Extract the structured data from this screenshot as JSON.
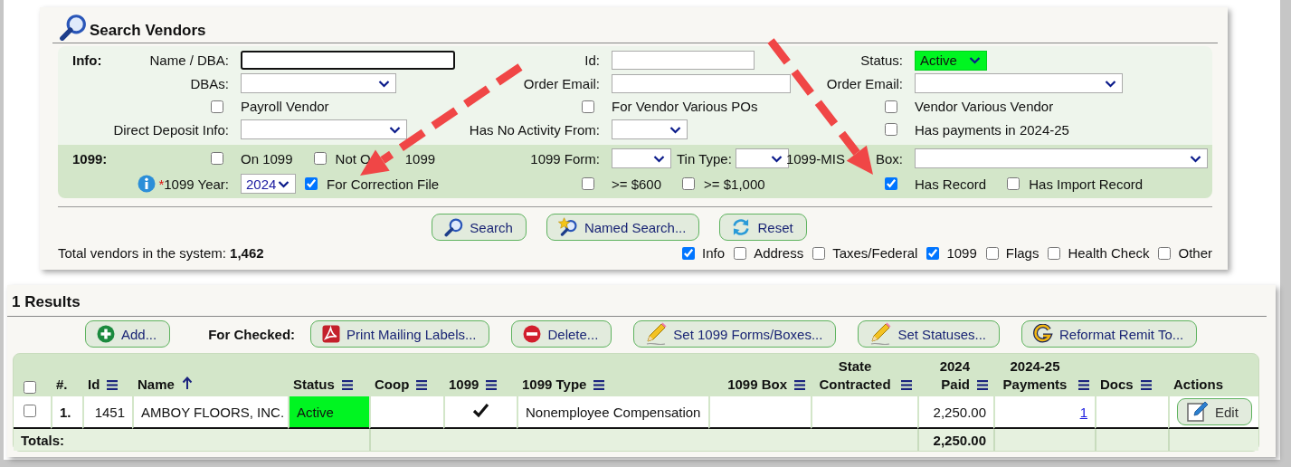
{
  "title": "Search Vendors",
  "form": {
    "sections": [
      {
        "label": "Info:",
        "rows": [
          {
            "groups": [
              {
                "lead": [
                  {
                    "kind": "label",
                    "text": "Name / DBA:"
                  }
                ],
                "body": [
                  {
                    "kind": "input",
                    "focused": true
                  }
                ]
              },
              {
                "lead": [
                  {
                    "kind": "label",
                    "text": "Id:"
                  }
                ],
                "body": [
                  {
                    "kind": "input",
                    "focused": false
                  }
                ]
              },
              {
                "lead": [
                  {
                    "kind": "label",
                    "text": "Status:"
                  }
                ],
                "body": [
                  {
                    "kind": "select",
                    "value": "Active",
                    "highlight": true
                  }
                ]
              }
            ]
          },
          {
            "groups": [
              {
                "lead": [
                  {
                    "kind": "label",
                    "text": "DBAs:"
                  }
                ],
                "body": [
                  {
                    "kind": "select",
                    "highlight": false
                  }
                ]
              },
              {
                "lead": [
                  {
                    "kind": "label",
                    "text": "Order Email:"
                  }
                ],
                "body": [
                  {
                    "kind": "input",
                    "focused": false
                  }
                ]
              },
              {
                "lead": [
                  {
                    "kind": "label",
                    "text": "Order Email:"
                  }
                ],
                "body": [
                  {
                    "kind": "select",
                    "highlight": false
                  }
                ]
              }
            ]
          },
          {
            "groups": [
              {
                "lead": [
                  {
                    "kind": "checkbox",
                    "checked": false
                  }
                ],
                "body": [
                  {
                    "kind": "text",
                    "text": "Payroll Vendor"
                  }
                ]
              },
              {
                "lead": [
                  {
                    "kind": "checkbox",
                    "checked": false
                  }
                ],
                "body": [
                  {
                    "kind": "text",
                    "text": "For Vendor Various POs"
                  }
                ]
              },
              {
                "lead": [
                  {
                    "kind": "checkbox",
                    "checked": false
                  }
                ],
                "body": [
                  {
                    "kind": "text",
                    "text": "Vendor Various Vendor"
                  }
                ]
              }
            ]
          },
          {
            "groups": [
              {
                "lead": [
                  {
                    "kind": "label",
                    "text": "Direct Deposit Info:"
                  }
                ],
                "body": [
                  {
                    "kind": "select",
                    "highlight": false
                  }
                ]
              },
              {
                "lead": [
                  {
                    "kind": "label",
                    "text": "Has No Activity From:"
                  }
                ],
                "body": [
                  {
                    "kind": "select",
                    "highlight": false
                  }
                ]
              },
              {
                "lead": [
                  {
                    "kind": "checkbox",
                    "checked": false
                  }
                ],
                "body": [
                  {
                    "kind": "text",
                    "text": "Has payments in 2024-25"
                  }
                ]
              }
            ]
          }
        ]
      },
      {
        "label": "1099:",
        "rows": [
          {
            "groups": [
              {
                "lead": [
                  {
                    "kind": "checkbox",
                    "checked": false
                  }
                ],
                "body": [
                  {
                    "kind": "text",
                    "text": "On 1099"
                  },
                  {
                    "kind": "checkbox",
                    "checked": false
                  },
                  {
                    "kind": "fragment",
                    "text": "Not O"
                  },
                  {
                    "kind": "text",
                    "text": "1099"
                  }
                ]
              },
              {
                "lead": [
                  {
                    "kind": "label",
                    "text": "1099 Form:"
                  }
                ],
                "body": [
                  {
                    "kind": "select",
                    "highlight": false
                  },
                  {
                    "kind": "label",
                    "text": "Tin Type:"
                  },
                  {
                    "kind": "select",
                    "highlight": false
                  }
                ]
              },
              {
                "lead": [
                  {
                    "kind": "fragment",
                    "text": "1099-MIS"
                  },
                  {
                    "kind": "label",
                    "text": "Box:"
                  }
                ],
                "body": [
                  {
                    "kind": "select",
                    "highlight": false
                  }
                ]
              }
            ]
          },
          {
            "groups": [
              {
                "lead": [
                  {
                    "kind": "info"
                  },
                  {
                    "kind": "required",
                    "text": "*"
                  },
                  {
                    "kind": "label",
                    "text": "1099 Year:"
                  }
                ],
                "body": [
                  {
                    "kind": "select",
                    "value": "2024",
                    "highlight": false
                  },
                  {
                    "kind": "checkbox",
                    "checked": true
                  },
                  {
                    "kind": "text",
                    "text": "For Correction File"
                  }
                ]
              },
              {
                "lead": [
                  {
                    "kind": "checkbox",
                    "checked": false
                  }
                ],
                "body": [
                  {
                    "kind": "text",
                    "text": ">= $600"
                  },
                  {
                    "kind": "checkbox",
                    "checked": false
                  },
                  {
                    "kind": "text",
                    "text": ">= $1,000"
                  }
                ]
              },
              {
                "lead": [
                  {
                    "kind": "checkbox",
                    "checked": true
                  }
                ],
                "body": [
                  {
                    "kind": "text",
                    "text": "Has Record"
                  },
                  {
                    "kind": "checkbox",
                    "checked": false
                  },
                  {
                    "kind": "text",
                    "text": "Has Import Record"
                  }
                ]
              }
            ]
          }
        ]
      }
    ]
  },
  "buttons": [
    {
      "label": "Search"
    },
    {
      "label": "Named Search..."
    },
    {
      "label": "Reset"
    }
  ],
  "total": "Total vendors in the system: **1,462**",
  "column_toggles": [
    {
      "label": "Info",
      "checked": true
    },
    {
      "label": "Address",
      "checked": false
    },
    {
      "label": "Taxes/Federal",
      "checked": false
    },
    {
      "label": "1099",
      "checked": true
    },
    {
      "label": "Flags",
      "checked": false
    },
    {
      "label": "Health Check",
      "checked": false
    },
    {
      "label": "Other",
      "checked": false
    }
  ],
  "results": {
    "title": "1 Results",
    "actions": [
      {
        "label": "Add..."
      }
    ],
    "for_checked_label": "For Checked:",
    "checked_actions": [
      {
        "label": "Print Mailing Labels..."
      },
      {
        "label": "Delete..."
      },
      {
        "label": "Set 1099 Forms/Boxes..."
      },
      {
        "label": "Set Statuses..."
      },
      {
        "label": "Reformat Remit To..."
      }
    ],
    "table": {
      "columns": [
        {
          "kind": "select_all",
          "checked": false
        },
        {
          "label": "#.",
          "menu": false
        },
        {
          "label": "Id",
          "menu": true
        },
        {
          "label": "Name",
          "menu": false,
          "sorted": true
        },
        {
          "label": "Status",
          "menu": true
        },
        {
          "label": "Coop",
          "menu": true
        },
        {
          "label": "1099",
          "menu": true
        },
        {
          "label": "1099 Type",
          "menu": true
        },
        {
          "label": "1099 Box",
          "menu": true
        },
        {
          "label": "State Contracted",
          "menu": true
        },
        {
          "label": "2024 Paid",
          "menu": true
        },
        {
          "label": "2024-25 Payments",
          "menu": true
        },
        {
          "label": "Docs",
          "menu": true
        },
        {
          "label": "Actions",
          "menu": false
        }
      ],
      "rows": [
        {
          "cells": [
            {
              "kind": "checkbox",
              "checked": false
            },
            {
              "kind": "index",
              "text": "1."
            },
            {
              "kind": "num",
              "text": "1451"
            },
            {
              "kind": "text",
              "text": "AMBOY FLOORS, INC."
            },
            {
              "kind": "status",
              "text": "Active",
              "highlight": true
            },
            {
              "kind": "empty"
            },
            {
              "kind": "check",
              "checked": true
            },
            {
              "kind": "text",
              "text": "Nonemployee Compensation"
            },
            {
              "kind": "empty"
            },
            {
              "kind": "empty"
            },
            {
              "kind": "num",
              "text": "2,250.00"
            },
            {
              "kind": "link",
              "text": "1"
            },
            {
              "kind": "empty"
            },
            {
              "kind": "edit",
              "text": "Edit"
            }
          ]
        }
      ],
      "totals": {
        "label": "Totals:",
        "paid": "2,250.00"
      }
    }
  }
}
